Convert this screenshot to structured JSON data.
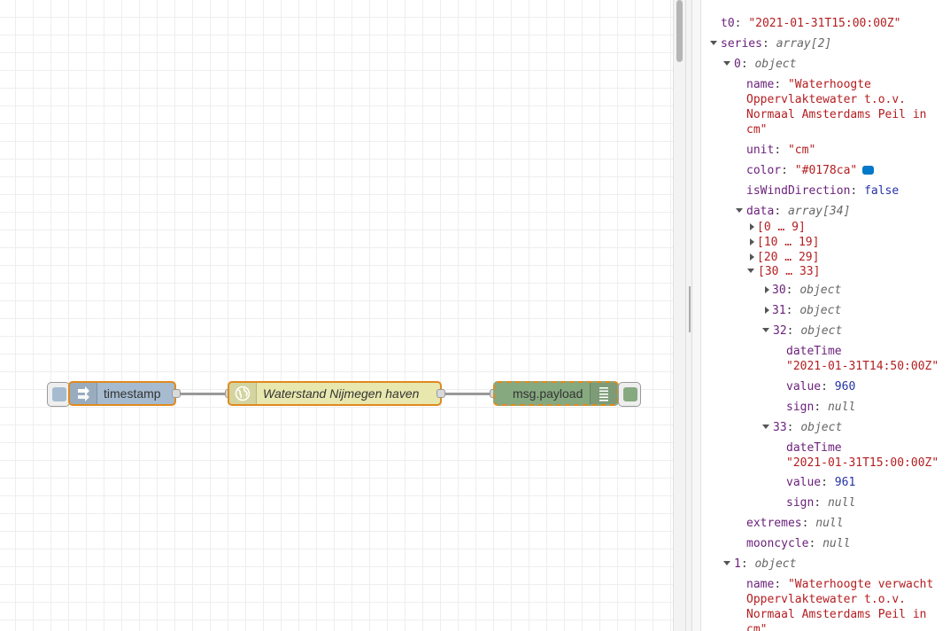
{
  "workspace": {
    "nodes": {
      "inject": {
        "label": "timestamp",
        "color": "#a6bbcf"
      },
      "function": {
        "label": "Waterstand Nijmegen haven",
        "color": "#e7e7ae"
      },
      "debug": {
        "label": "msg.payload",
        "color": "#87a980"
      }
    }
  },
  "debug_panel": {
    "t0": {
      "key": "t0",
      "value": "\"2021-01-31T15:00:00Z\""
    },
    "series": {
      "key": "series",
      "type": "array[2]"
    },
    "s0": {
      "key": "0",
      "type": "object",
      "name_key": "name",
      "name_lines": [
        "\"Waterhoogte",
        "Oppervlaktewater t.o.v.",
        "Normaal Amsterdams Peil in",
        "cm\""
      ],
      "unit_key": "unit",
      "unit_value": "\"cm\"",
      "color_key": "color",
      "color_value": "\"#0178ca\"",
      "color_hex": "#0178ca",
      "wind_key": "isWindDirection",
      "wind_value": "false",
      "data_key": "data",
      "data_type": "array[34]",
      "ranges": [
        "[0 … 9]",
        "[10 … 19]",
        "[20 … 29]",
        "[30 … 33]"
      ],
      "item30": {
        "key": "30",
        "type": "object"
      },
      "item31": {
        "key": "31",
        "type": "object"
      },
      "item32": {
        "key": "32",
        "type": "object",
        "dateTime_key": "dateTime",
        "dateTime_value": "\"2021-01-31T14:50:00Z\"",
        "value_key": "value",
        "value": "960",
        "sign_key": "sign",
        "sign_value": "null"
      },
      "item33": {
        "key": "33",
        "type": "object",
        "dateTime_key": "dateTime",
        "dateTime_value": "\"2021-01-31T15:00:00Z\"",
        "value_key": "value",
        "value": "961",
        "sign_key": "sign",
        "sign_value": "null"
      },
      "extremes_key": "extremes",
      "extremes_value": "null",
      "mooncycle_key": "mooncycle",
      "mooncycle_value": "null"
    },
    "s1": {
      "key": "1",
      "type": "object",
      "name_key": "name",
      "name_lines": [
        "\"Waterhoogte verwacht",
        "Oppervlaktewater t.o.v.",
        "Normaal Amsterdams Peil in",
        "cm\""
      ]
    }
  }
}
